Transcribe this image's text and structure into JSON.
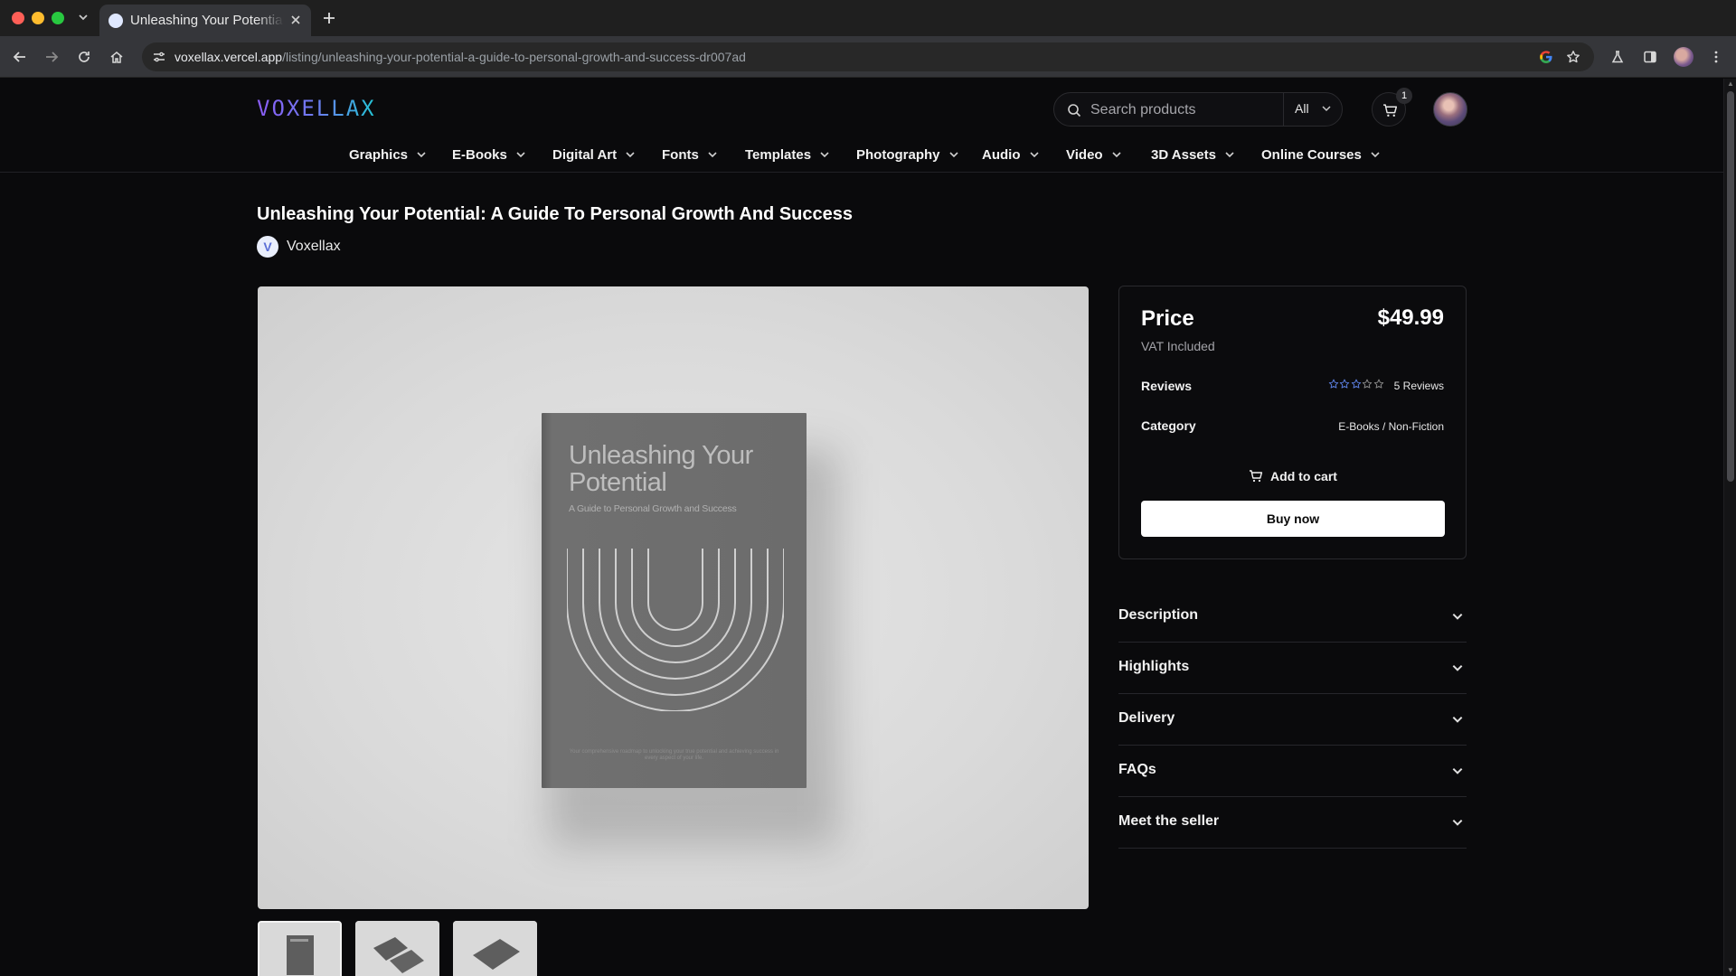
{
  "browser": {
    "tab_title": "Unleashing Your Potential: A Guide To Personal Growth And Success",
    "url_host": "voxellax.vercel.app",
    "url_path": "/listing/unleashing-your-potential-a-guide-to-personal-growth-and-success-dr007ad"
  },
  "header": {
    "logo": "VOXELLAX",
    "search_placeholder": "Search products",
    "search_category": "All",
    "cart_count": "1"
  },
  "categories": [
    {
      "label": "Graphics"
    },
    {
      "label": "E-Books"
    },
    {
      "label": "Digital Art"
    },
    {
      "label": "Fonts"
    },
    {
      "label": "Templates"
    },
    {
      "label": "Photography"
    },
    {
      "label": "Audio"
    },
    {
      "label": "Video"
    },
    {
      "label": "3D Assets"
    },
    {
      "label": "Online Courses"
    }
  ],
  "product": {
    "title": "Unleashing Your Potential: A Guide To Personal Growth And Success",
    "seller_name": "Voxellax",
    "seller_initial": "V",
    "cover": {
      "title": "Unleashing Your Potential",
      "subtitle": "A Guide to Personal Growth and Success",
      "footer": "Your comprehensive roadmap to unlocking your true potential and achieving success in every aspect of your life."
    }
  },
  "purchase": {
    "price_label": "Price",
    "price": "$49.99",
    "vat_note": "VAT Included",
    "reviews_label": "Reviews",
    "rating": 0,
    "rating_max": 5,
    "reviews_count": "5 Reviews",
    "category_label": "Category",
    "category_value": "E-Books / Non-Fiction",
    "add_to_cart": "Add to cart",
    "buy_now": "Buy now"
  },
  "accordion": [
    {
      "label": "Description"
    },
    {
      "label": "Highlights"
    },
    {
      "label": "Delivery"
    },
    {
      "label": "FAQs"
    },
    {
      "label": "Meet the seller"
    }
  ],
  "colors": {
    "page_bg": "#0a0a0c",
    "star_outline": "#5b7fe0",
    "logo_gradient": [
      "#8b5cf6",
      "#22c5d4"
    ]
  }
}
